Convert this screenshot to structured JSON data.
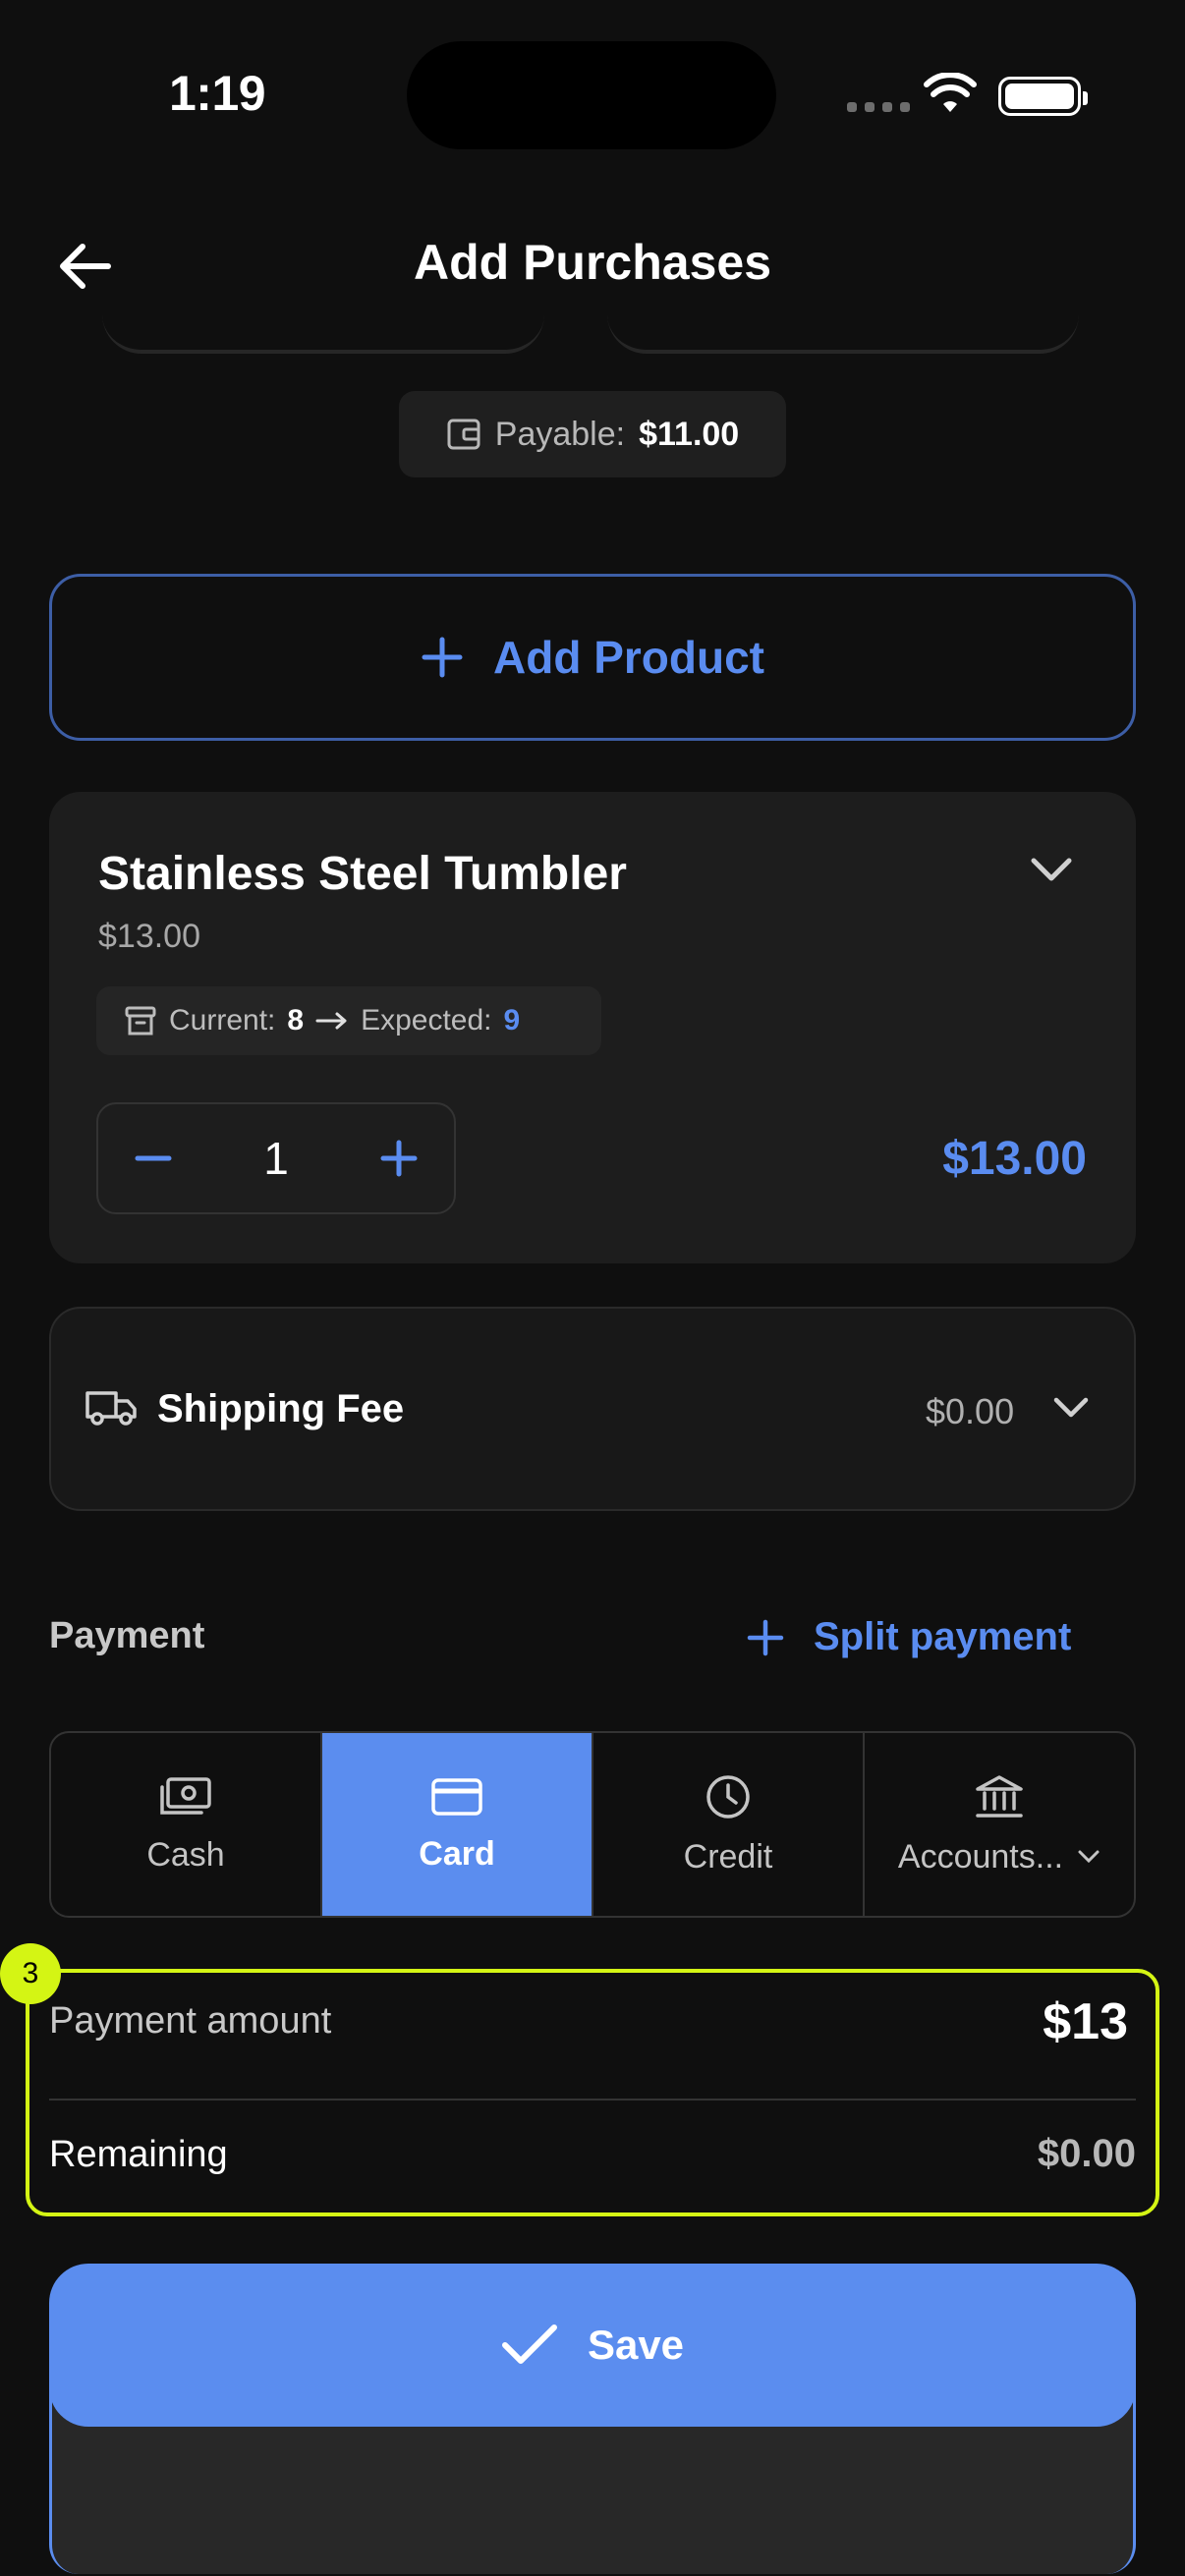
{
  "status_bar": {
    "time": "1:19"
  },
  "header": {
    "title": "Add Purchases"
  },
  "payable": {
    "label": "Payable:",
    "value": "$11.00"
  },
  "add_product": {
    "label": "Add Product"
  },
  "product": {
    "name": "Stainless Steel Tumbler",
    "price": "$13.00",
    "current_label": "Current:",
    "current_value": "8",
    "expected_label": "Expected:",
    "expected_value": "9",
    "quantity": "1",
    "line_total": "$13.00"
  },
  "shipping": {
    "label": "Shipping Fee",
    "value": "$0.00"
  },
  "payment": {
    "label": "Payment",
    "split_label": "Split payment",
    "methods": [
      {
        "label": "Cash",
        "icon": "cash-icon"
      },
      {
        "label": "Card",
        "icon": "card-icon",
        "active": true
      },
      {
        "label": "Credit",
        "icon": "clock-icon"
      },
      {
        "label": "Accounts...",
        "icon": "bank-icon"
      }
    ],
    "amount_label": "Payment amount",
    "amount_value": "$13",
    "remaining_label": "Remaining",
    "remaining_value": "$0.00"
  },
  "annotation": {
    "badge": "3"
  },
  "save": {
    "label": "Save"
  },
  "colors": {
    "accent": "#5b8def",
    "highlight": "#d4f514",
    "background": "#0f0f0f"
  }
}
